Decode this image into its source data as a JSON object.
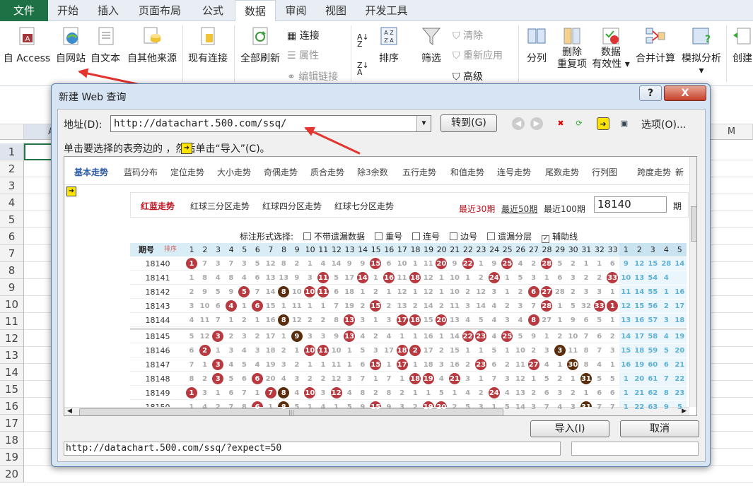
{
  "tabs": [
    "文件",
    "开始",
    "插入",
    "页面布局",
    "公式",
    "数据",
    "审阅",
    "视图",
    "开发工具"
  ],
  "active_tab": "数据",
  "ribbon": {
    "get_external": [
      "自 Access",
      "自网站",
      "自文本",
      "自其他来源"
    ],
    "existing_connections": "现有连接",
    "refresh_all": "全部刷新",
    "connections": "连接",
    "properties": "属性",
    "edit_links": "编辑链接",
    "sort": "排序",
    "filter": "筛选",
    "clear": "清除",
    "reapply": "重新应用",
    "advanced": "高级",
    "text_to_columns": "分列",
    "remove_dup_1": "删除",
    "remove_dup_2": "重复项",
    "validation_1": "数据",
    "validation_2": "有效性",
    "consolidate": "合并计算",
    "what_if": "模拟分析",
    "create": "创建"
  },
  "sheet": {
    "columns": [
      "A",
      "M"
    ],
    "rows": [
      "1",
      "2",
      "3",
      "4",
      "5",
      "6",
      "7",
      "8",
      "9",
      "10",
      "11",
      "12",
      "13",
      "14",
      "15",
      "16",
      "17",
      "18",
      "19",
      "20"
    ]
  },
  "dialog": {
    "title": "新建 Web 查询",
    "help": "?",
    "close": "X",
    "address_label": "地址(D):",
    "address_value": "http://datachart.500.com/ssq/",
    "go_button": "转到(G)",
    "options_button": "选项(O)...",
    "hint": "单击要选择的表旁边的    ，然后单击“导入”(C)。",
    "import_button": "导入(I)",
    "cancel_button": "取消",
    "status_url": "http://datachart.500.com/ssq/?expect=50"
  },
  "webpage": {
    "nav": [
      "基本走势",
      "蓝码分布",
      "定位走势",
      "大小走势",
      "奇偶走势",
      "质合走势",
      "除3余数",
      "五行走势",
      "和值走势",
      "连号走势",
      "尾数走势",
      "行列图",
      "跨度走势",
      "新"
    ],
    "subtabs": [
      "红蓝走势",
      "红球三分区走势",
      "红球四分区走势",
      "红球七分区走势"
    ],
    "recent": [
      "最近30期",
      "最近50期",
      "最近100期"
    ],
    "issue_value": "18140",
    "issue_suffix": "期 ",
    "options_label": "标注形式选择:",
    "options": [
      {
        "label": "不带遗漏数据",
        "checked": false
      },
      {
        "label": "重号",
        "checked": false
      },
      {
        "label": "连号",
        "checked": false
      },
      {
        "label": "边号",
        "checked": false
      },
      {
        "label": "遗漏分层",
        "checked": false
      },
      {
        "label": "辅助线",
        "checked": true
      }
    ],
    "period_header": "期号",
    "sort_header": "排序",
    "red_numbers": [
      "1",
      "2",
      "3",
      "4",
      "5",
      "6",
      "7",
      "8",
      "9",
      "10",
      "11",
      "12",
      "13",
      "14",
      "15",
      "16",
      "17",
      "18",
      "19",
      "20",
      "21",
      "22",
      "23",
      "24",
      "25",
      "26",
      "27",
      "28",
      "29",
      "30",
      "31",
      "32",
      "33"
    ],
    "blue_numbers": [
      "1",
      "2",
      "3",
      "4",
      "5"
    ],
    "rows": [
      {
        "issue": "18140",
        "cells": [
          "1",
          "7",
          "3",
          "7",
          "3",
          "5",
          "12",
          "8",
          "2",
          "1",
          "4",
          "14",
          "9",
          "9",
          "15",
          "6",
          "10",
          "1",
          "11",
          "20",
          "9",
          "22",
          "1",
          "9",
          "25",
          "4",
          "2",
          "28",
          "5",
          "2",
          "1",
          "1",
          "6"
        ],
        "red": [
          1,
          15,
          20,
          22,
          25,
          28
        ],
        "blue": [
          "9",
          "12",
          "15",
          "28",
          "14"
        ]
      },
      {
        "issue": "18141",
        "cells": [
          "1",
          "8",
          "4",
          "8",
          "4",
          "6",
          "13",
          "13",
          "9",
          "3",
          "11",
          "5",
          "17",
          "14",
          "1",
          "16",
          "11",
          "18",
          "12",
          "1",
          "10",
          "1",
          "2",
          "24",
          "1",
          "5",
          "3",
          "1",
          "6",
          "3",
          "2",
          "2",
          "33"
        ],
        "red": [
          11,
          14,
          16,
          18,
          24,
          33
        ],
        "blue": [
          "10",
          "13",
          "54",
          "4",
          ""
        ]
      },
      {
        "issue": "18142",
        "cells": [
          "2",
          "9",
          "5",
          "9",
          "5",
          "7",
          "14",
          "8",
          "10",
          "10",
          "11",
          "6",
          "18",
          "1",
          "2",
          "1",
          "12",
          "1",
          "12",
          "1",
          "10",
          "2",
          "12",
          "3",
          "1",
          "2",
          "6",
          "27",
          "28",
          "2",
          "3",
          "3",
          "1"
        ],
        "red": [
          5,
          8,
          10,
          11,
          27,
          28
        ],
        "blue": [
          "11",
          "14",
          "55",
          "1",
          "16"
        ]
      },
      {
        "issue": "18143",
        "cells": [
          "3",
          "10",
          "6",
          "4",
          "1",
          "6",
          "15",
          "1",
          "11",
          "1",
          "1",
          "7",
          "19",
          "2",
          "15",
          "2",
          "13",
          "2",
          "14",
          "2",
          "11",
          "3",
          "14",
          "4",
          "2",
          "3",
          "7",
          "28",
          "1",
          "5",
          "32",
          "33",
          "1"
        ],
        "red": [
          4,
          6,
          15,
          28,
          32,
          33
        ],
        "blue": [
          "12",
          "15",
          "56",
          "2",
          "17"
        ]
      },
      {
        "issue": "18144",
        "cells": [
          "4",
          "11",
          "7",
          "1",
          "2",
          "1",
          "16",
          "8",
          "12",
          "2",
          "2",
          "8",
          "13",
          "3",
          "1",
          "3",
          "17",
          "18",
          "15",
          "20",
          "13",
          "4",
          "5",
          "4",
          "3",
          "4",
          "8",
          "27",
          "1",
          "9",
          "6",
          "5",
          "1"
        ],
        "red": [
          8,
          13,
          17,
          18,
          20,
          27
        ],
        "blue": [
          "13",
          "16",
          "57",
          "3",
          "18"
        ]
      },
      {
        "issue": "18145",
        "cells": [
          "5",
          "12",
          "3",
          "2",
          "3",
          "2",
          "17",
          "1",
          "9",
          "3",
          "3",
          "9",
          "13",
          "4",
          "2",
          "4",
          "1",
          "1",
          "16",
          "1",
          "14",
          "22",
          "23",
          "4",
          "25",
          "5",
          "9",
          "1",
          "2",
          "10",
          "7",
          "6",
          "2"
        ],
        "red": [
          3,
          9,
          13,
          22,
          23,
          25
        ],
        "blue": [
          "14",
          "17",
          "58",
          "4",
          "19"
        ]
      },
      {
        "issue": "18146",
        "cells": [
          "6",
          "2",
          "1",
          "3",
          "4",
          "3",
          "18",
          "2",
          "1",
          "10",
          "11",
          "10",
          "1",
          "5",
          "3",
          "17",
          "18",
          "2",
          "17",
          "2",
          "15",
          "1",
          "1",
          "5",
          "1",
          "10",
          "2",
          "3",
          "3",
          "11",
          "8",
          "7",
          "3"
        ],
        "red": [
          2,
          10,
          11,
          17,
          18,
          29
        ],
        "blue": [
          "15",
          "18",
          "59",
          "5",
          "20"
        ]
      },
      {
        "issue": "18147",
        "cells": [
          "7",
          "1",
          "3",
          "4",
          "5",
          "4",
          "19",
          "3",
          "2",
          "1",
          "1",
          "11",
          "1",
          "6",
          "15",
          "1",
          "17",
          "1",
          "18",
          "3",
          "16",
          "2",
          "23",
          "6",
          "2",
          "11",
          "27",
          "4",
          "1",
          "30",
          "8",
          "4",
          "1"
        ],
        "red": [
          3,
          15,
          17,
          23,
          27,
          30
        ],
        "blue": [
          "16",
          "19",
          "60",
          "6",
          "21"
        ]
      },
      {
        "issue": "18148",
        "cells": [
          "8",
          "2",
          "3",
          "5",
          "6",
          "6",
          "20",
          "4",
          "3",
          "2",
          "2",
          "12",
          "3",
          "7",
          "1",
          "7",
          "1",
          "18",
          "19",
          "4",
          "21",
          "3",
          "1",
          "7",
          "3",
          "12",
          "1",
          "5",
          "2",
          "1",
          "31",
          "5",
          "5"
        ],
        "red": [
          3,
          6,
          18,
          19,
          21,
          31
        ],
        "blue": [
          "1",
          "20",
          "61",
          "7",
          "22"
        ]
      },
      {
        "issue": "18149",
        "cells": [
          "1",
          "3",
          "1",
          "6",
          "7",
          "1",
          "7",
          "8",
          "4",
          "10",
          "3",
          "12",
          "4",
          "8",
          "2",
          "8",
          "2",
          "1",
          "1",
          "5",
          "1",
          "4",
          "2",
          "24",
          "4",
          "13",
          "2",
          "6",
          "3",
          "2",
          "1",
          "6",
          "6"
        ],
        "red": [
          1,
          7,
          8,
          10,
          12,
          24
        ],
        "blue": [
          "1",
          "21",
          "62",
          "8",
          "23"
        ]
      },
      {
        "issue": "18150",
        "cells": [
          "1",
          "4",
          "2",
          "7",
          "8",
          "6",
          "1",
          "8",
          "5",
          "1",
          "4",
          "1",
          "5",
          "9",
          "15",
          "9",
          "3",
          "2",
          "19",
          "20",
          "2",
          "5",
          "3",
          "1",
          "5",
          "14",
          "3",
          "7",
          "4",
          "3",
          "31",
          "7",
          "7"
        ],
        "red": [
          6,
          8,
          15,
          19,
          20,
          31
        ],
        "blue": [
          "1",
          "22",
          "63",
          "9",
          "5"
        ]
      }
    ]
  },
  "colors": {
    "excel_green": "#1e7145",
    "red_ball": "#b8393f",
    "brown_ball": "#5a2d0c",
    "blue_ball": "#2a77a6",
    "arrow_red": "#e3342f"
  }
}
